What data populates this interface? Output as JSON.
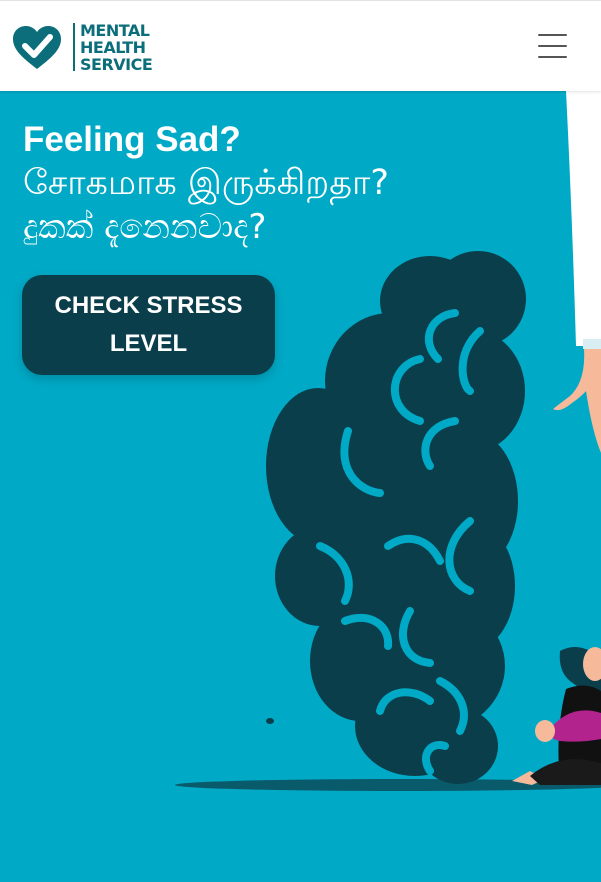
{
  "header": {
    "logo": {
      "lines": [
        "MENTAL",
        "HEALTH",
        "SERVICE"
      ],
      "icon": "heart-check-icon"
    },
    "menu": {
      "icon": "hamburger-menu-icon"
    }
  },
  "hero": {
    "headline": {
      "line1": "Feeling Sad?",
      "line2": "சோகமாக இருக்கிறதா?",
      "line3": "දුකක් දැනෙනවාද?"
    },
    "cta_label": "CHECK STRESS LEVEL"
  },
  "colors": {
    "brand": "#0b6e7a",
    "hero_background": "#00a9c6",
    "brain": "#0b3e4b",
    "button": "#0b3e4b",
    "figure_shirt": "#b3238e"
  }
}
